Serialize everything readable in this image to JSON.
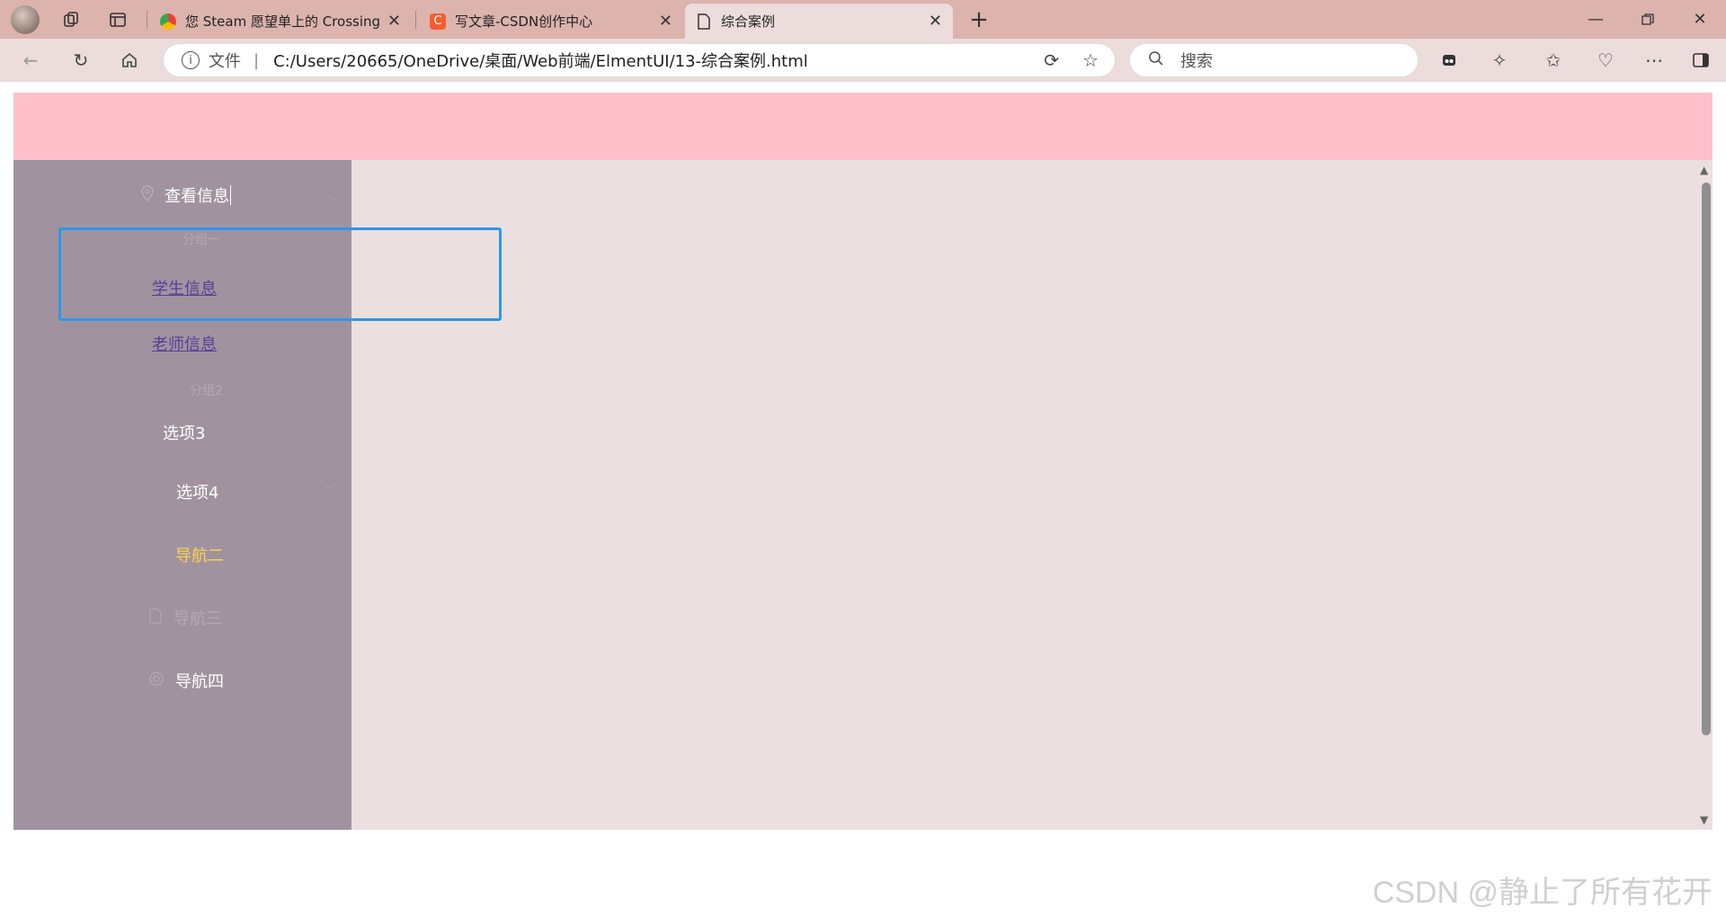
{
  "browser": {
    "tabs": [
      {
        "title": "您 Steam 愿望单上的 Crossing Gu",
        "favicon": "chrome-icon",
        "active": false
      },
      {
        "title": "写文章-CSDN创作中心",
        "favicon": "csdn-icon",
        "active": false
      },
      {
        "title": "综合案例",
        "favicon": "document-icon",
        "active": true
      }
    ],
    "new_tab_label": "+",
    "address": {
      "scheme_label": "文件",
      "url": "C:/Users/20665/OneDrive/桌面/Web前端/ElmentUI/13-综合案例.html"
    },
    "search_placeholder": "搜索",
    "colors": {
      "tabstrip": "#dcb3ad",
      "toolbar": "#ecdcdc"
    }
  },
  "page": {
    "colors": {
      "header": "#ffc0cb",
      "aside": "#a0939f",
      "main": "#ecdfdf",
      "active_text": "#ffd04b",
      "focus_outline": "#2f96ec"
    },
    "menu": {
      "group1_title": "查看信息",
      "group1_sub_label": "分组一",
      "student_info": "学生信息",
      "teacher_info": "老师信息",
      "group2_label": "分组2",
      "option3": "选项3",
      "option4": "选项4",
      "nav2": "导航二",
      "nav3": "导航三",
      "nav4": "导航四"
    }
  },
  "watermark": "CSDN @静止了所有花开"
}
